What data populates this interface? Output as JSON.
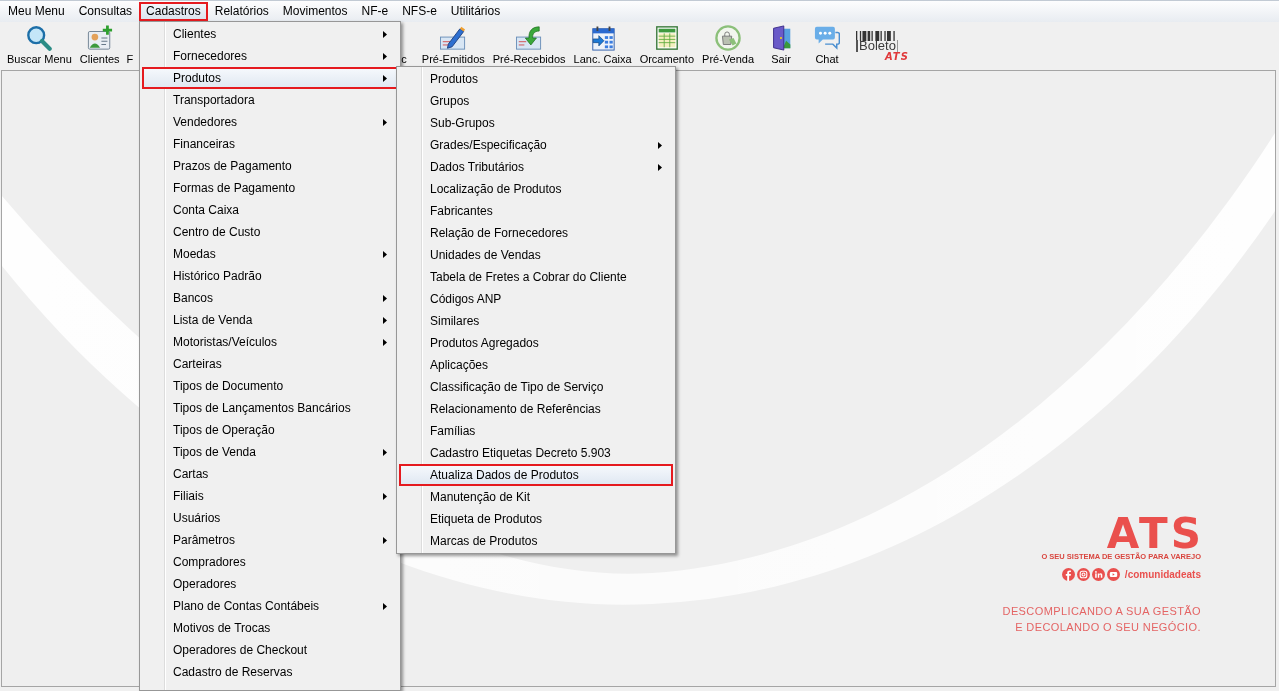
{
  "menu_bar": [
    {
      "label": "Meu Menu",
      "selected": false
    },
    {
      "label": "Consultas",
      "selected": false
    },
    {
      "label": "Cadastros",
      "selected": true
    },
    {
      "label": "Relatórios",
      "selected": false
    },
    {
      "label": "Movimentos",
      "selected": false
    },
    {
      "label": "NF-e",
      "selected": false
    },
    {
      "label": "NFS-e",
      "selected": false
    },
    {
      "label": "Utilitários",
      "selected": false
    }
  ],
  "toolbar": [
    {
      "label": "Buscar Menu",
      "kind": "search"
    },
    {
      "label": "Clientes",
      "kind": "contact"
    },
    {
      "label": "F",
      "kind": "partial"
    },
    {
      "label": "c",
      "kind": "partial"
    },
    {
      "label": "Pré-Emitidos",
      "kind": "pen"
    },
    {
      "label": "Pré-Recebidos",
      "kind": "receive"
    },
    {
      "label": "Lanc. Caixa",
      "kind": "calendar"
    },
    {
      "label": "Orcamento",
      "kind": "sheet"
    },
    {
      "label": "Pré-Venda",
      "kind": "bag"
    },
    {
      "label": "Sair",
      "kind": "door"
    },
    {
      "label": "Chat",
      "kind": "chat"
    },
    {
      "label": "Boleto",
      "badge": "ATS",
      "kind": "boleto"
    }
  ],
  "cadastros_menu": [
    {
      "label": "Clientes",
      "has_submenu": true,
      "selected": false
    },
    {
      "label": "Fornecedores",
      "has_submenu": true,
      "selected": false
    },
    {
      "label": "Produtos",
      "has_submenu": true,
      "selected": true
    },
    {
      "label": "Transportadora",
      "has_submenu": false,
      "selected": false
    },
    {
      "label": "Vendedores",
      "has_submenu": true,
      "selected": false
    },
    {
      "label": "Financeiras",
      "has_submenu": false,
      "selected": false
    },
    {
      "label": "Prazos de Pagamento",
      "has_submenu": false,
      "selected": false
    },
    {
      "label": "Formas de Pagamento",
      "has_submenu": false,
      "selected": false
    },
    {
      "label": "Conta Caixa",
      "has_submenu": false,
      "selected": false
    },
    {
      "label": "Centro de Custo",
      "has_submenu": false,
      "selected": false
    },
    {
      "label": "Moedas",
      "has_submenu": true,
      "selected": false
    },
    {
      "label": "Histórico Padrão",
      "has_submenu": false,
      "selected": false
    },
    {
      "label": "Bancos",
      "has_submenu": true,
      "selected": false
    },
    {
      "label": "Lista de Venda",
      "has_submenu": true,
      "selected": false
    },
    {
      "label": "Motoristas/Veículos",
      "has_submenu": true,
      "selected": false
    },
    {
      "label": "Carteiras",
      "has_submenu": false,
      "selected": false
    },
    {
      "label": "Tipos de Documento",
      "has_submenu": false,
      "selected": false
    },
    {
      "label": "Tipos de Lançamentos Bancários",
      "has_submenu": false,
      "selected": false
    },
    {
      "label": "Tipos de Operação",
      "has_submenu": false,
      "selected": false
    },
    {
      "label": "Tipos de Venda",
      "has_submenu": true,
      "selected": false
    },
    {
      "label": "Cartas",
      "has_submenu": false,
      "selected": false
    },
    {
      "label": "Filiais",
      "has_submenu": true,
      "selected": false
    },
    {
      "label": "Usuários",
      "has_submenu": false,
      "selected": false
    },
    {
      "label": "Parâmetros",
      "has_submenu": true,
      "selected": false
    },
    {
      "label": "Compradores",
      "has_submenu": false,
      "selected": false
    },
    {
      "label": "Operadores",
      "has_submenu": false,
      "selected": false
    },
    {
      "label": "Plano de Contas Contábeis",
      "has_submenu": true,
      "selected": false
    },
    {
      "label": "Motivos de Trocas",
      "has_submenu": false,
      "selected": false
    },
    {
      "label": "Operadores de Checkout",
      "has_submenu": false,
      "selected": false
    },
    {
      "label": "Cadastro de Reservas",
      "has_submenu": false,
      "selected": false
    }
  ],
  "produtos_submenu": [
    {
      "label": "Produtos",
      "has_submenu": false,
      "selected": false
    },
    {
      "label": "Grupos",
      "has_submenu": false,
      "selected": false
    },
    {
      "label": "Sub-Grupos",
      "has_submenu": false,
      "selected": false
    },
    {
      "label": "Grades/Especificação",
      "has_submenu": true,
      "selected": false
    },
    {
      "label": "Dados Tributários",
      "has_submenu": true,
      "selected": false
    },
    {
      "label": "Localização de Produtos",
      "has_submenu": false,
      "selected": false
    },
    {
      "label": "Fabricantes",
      "has_submenu": false,
      "selected": false
    },
    {
      "label": "Relação de Fornecedores",
      "has_submenu": false,
      "selected": false
    },
    {
      "label": "Unidades de Vendas",
      "has_submenu": false,
      "selected": false
    },
    {
      "label": "Tabela de Fretes a Cobrar do Cliente",
      "has_submenu": false,
      "selected": false
    },
    {
      "label": "Códigos ANP",
      "has_submenu": false,
      "selected": false
    },
    {
      "label": "Similares",
      "has_submenu": false,
      "selected": false
    },
    {
      "label": "Produtos Agregados",
      "has_submenu": false,
      "selected": false
    },
    {
      "label": "Aplicações",
      "has_submenu": false,
      "selected": false
    },
    {
      "label": "Classificação de Tipo de Serviço",
      "has_submenu": false,
      "selected": false
    },
    {
      "label": "Relacionamento de Referências",
      "has_submenu": false,
      "selected": false
    },
    {
      "label": "Famílias",
      "has_submenu": false,
      "selected": false
    },
    {
      "label": "Cadastro Etiquetas Decreto 5.903",
      "has_submenu": false,
      "selected": false
    },
    {
      "label": "Atualiza Dados de Produtos",
      "has_submenu": false,
      "selected": true
    },
    {
      "label": "Manutenção de Kit",
      "has_submenu": false,
      "selected": false
    },
    {
      "label": "Etiqueta de Produtos",
      "has_submenu": false,
      "selected": false
    },
    {
      "label": "Marcas de Produtos",
      "has_submenu": false,
      "selected": false
    }
  ],
  "brand": {
    "logo": "ATS",
    "tagline": "O SEU SISTEMA DE GESTÃO PARA VAREJO",
    "social_handle": "/comunidadeats",
    "slogan_lines": [
      "DESCOMPLICANDO A SUA GESTÃO",
      "E DECOLANDO O SEU NEGÓCIO."
    ]
  }
}
